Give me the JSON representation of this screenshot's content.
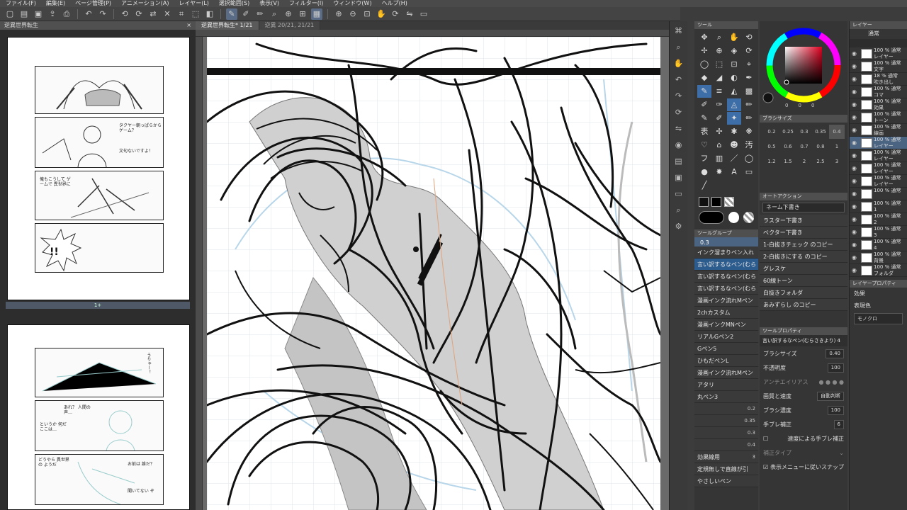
{
  "menu": [
    "ファイル(F)",
    "編集(E)",
    "ページ管理(P)",
    "アニメーション(A)",
    "レイヤー(L)",
    "選択範囲(S)",
    "表示(V)",
    "フィルター(I)",
    "ウィンドウ(W)",
    "ヘルプ(H)"
  ],
  "navigator": {
    "tab_label": "逆異世界転生",
    "page1_label": "1+",
    "page2_label": "2"
  },
  "doc_tabs": [
    "逆異世界転生* 1/21",
    "逆異 20/21, 21/21"
  ],
  "tool_panel": {
    "title": "ツール",
    "subtool_group_title": "ツールグループ",
    "current_value": "0.3"
  },
  "subtools": [
    {
      "label": "インク溜まりペン入れ",
      "value": ""
    },
    {
      "label": "言い訳するなペン(むら",
      "value": ""
    },
    {
      "label": "言い訳するなペン(むら",
      "value": ""
    },
    {
      "label": "言い訳するなペン(むら",
      "value": ""
    },
    {
      "label": "漫画インク流れMペン",
      "value": ""
    },
    {
      "label": "2chカスタム",
      "value": ""
    },
    {
      "label": "漫画インクMNペン",
      "value": ""
    },
    {
      "label": "リアルGペン2",
      "value": ""
    },
    {
      "label": "Gペン5",
      "value": ""
    },
    {
      "label": "ひもだペンL",
      "value": ""
    },
    {
      "label": "漫画インク流れMペン",
      "value": ""
    },
    {
      "label": "アタリ",
      "value": ""
    },
    {
      "label": "丸ペン3",
      "value": ""
    },
    {
      "label": "",
      "value": "0.2"
    },
    {
      "label": "",
      "value": "0.35"
    },
    {
      "label": "",
      "value": "0.3"
    },
    {
      "label": "",
      "value": "0.4"
    },
    {
      "label": "効果線用",
      "value": "3"
    },
    {
      "label": "定規無しで直線が引",
      "value": ""
    },
    {
      "label": "やさしいペン",
      "value": ""
    }
  ],
  "color": {
    "values": [
      "0",
      "0",
      "0"
    ]
  },
  "brush_size": {
    "title": "ブラシサイズ",
    "sizes": [
      "0.2",
      "0.25",
      "0.3",
      "0.35",
      "0.4",
      "0.5",
      "0.6",
      "0.7",
      "0.8",
      "1",
      "1.2",
      "1.5",
      "2",
      "2.5",
      "3"
    ],
    "selected": "0.4"
  },
  "auto_action": {
    "title": "オートアクション",
    "selected": "ネーム下書き",
    "items": [
      "ラスター下書き",
      "ベクター下書き",
      "1-白抜きチェック のコピー",
      "2-白抜きにする のコピー",
      "グレスケ",
      "60線トーン",
      "白抜きフォルダ",
      "あみずらし のコピー"
    ]
  },
  "tool_property": {
    "title": "ツールプロパティ",
    "current": "言い訳するなペン(むらさきより) 4",
    "brush_size_label": "ブラシサイズ",
    "brush_size_value": "0.40",
    "opacity_label": "不透明度",
    "opacity_value": "100",
    "antialias_label": "アンチエイリアス",
    "quality_label": "画質と速度",
    "quality_value": "自動判断",
    "brush_density_label": "ブラシ濃度",
    "brush_density_value": "100",
    "stabilization_label": "手ブレ補正",
    "stabilization_value": "6",
    "speed_label": "速度による手ブレ補正",
    "correction_type_label": "補正タイプ",
    "snap_label": "表示メニューに従いスナップ"
  },
  "layers": {
    "tab_label": "レイヤー",
    "blend_mode": "通常",
    "rows": [
      {
        "text": "100 % 通常",
        "sub": "レイヤー"
      },
      {
        "text": "100 % 通常",
        "sub": "文字"
      },
      {
        "text": "18 % 通常",
        "sub": "吹き出し"
      },
      {
        "text": "100 % 通常",
        "sub": "コマ"
      },
      {
        "text": "100 % 通常",
        "sub": "効果"
      },
      {
        "text": "100 % 通常",
        "sub": "トーン"
      },
      {
        "text": "100 % 通常",
        "sub": "線画"
      },
      {
        "text": "100 % 通常",
        "sub": "レイヤー"
      },
      {
        "text": "100 % 通常",
        "sub": "レイヤー"
      },
      {
        "text": "100 % 通常",
        "sub": "レイヤー"
      },
      {
        "text": "100 % 通常",
        "sub": "レイヤー"
      },
      {
        "text": "100 % 通常",
        "sub": ""
      },
      {
        "text": "100 % 通常",
        "sub": "1"
      },
      {
        "text": "100 % 通常",
        "sub": "2"
      },
      {
        "text": "100 % 通常",
        "sub": "3"
      },
      {
        "text": "100 % 通常",
        "sub": "4"
      },
      {
        "text": "100 % 通常",
        "sub": "背景"
      },
      {
        "text": "100 % 通常",
        "sub": "フォルダ"
      }
    ],
    "property_tab": "レイヤープロパティ",
    "effect_label": "効果",
    "expression_label": "表現色",
    "expression_value": "モノクロ"
  },
  "manga_text": {
    "page1": [
      "タクヤー朝っぱらからゲーム？",
      "文句ないですよ！",
      "俺もこうして ゲームで 異世界に"
    ],
    "page1_sfx": "!!",
    "page2": [
      "うりゃー！",
      "あれ？ 人間の 声…",
      "というか 何だここは…",
      "どうやら 異世界の ようだ",
      "お前は 誰だ？",
      "聞いてない ぞ"
    ]
  }
}
